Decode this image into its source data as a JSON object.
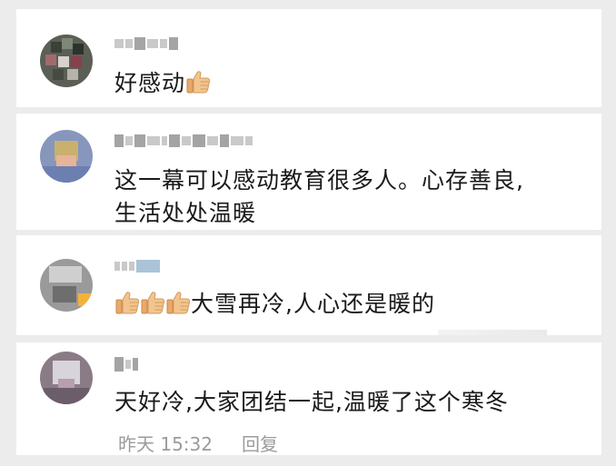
{
  "comments": [
    {
      "text": "好感动",
      "emojis": [
        "thumbs-up-icon"
      ]
    },
    {
      "text_line1": "这一幕可以感动教育很多人。心存善良,",
      "text_line2": "生活处处温暖"
    },
    {
      "text": "大雪再冷,人心还是暖的",
      "emojis": [
        "thumbs-up-icon",
        "thumbs-up-icon",
        "thumbs-up-icon"
      ]
    },
    {
      "text": "天好冷,大家团结一起,温暖了这个寒冬",
      "time": "昨天 15:32",
      "reply_label": "回复"
    }
  ],
  "colors": {
    "background": "#ececec",
    "card": "#ffffff",
    "text": "#1a1a1a",
    "meta": "#9b9b9b"
  }
}
